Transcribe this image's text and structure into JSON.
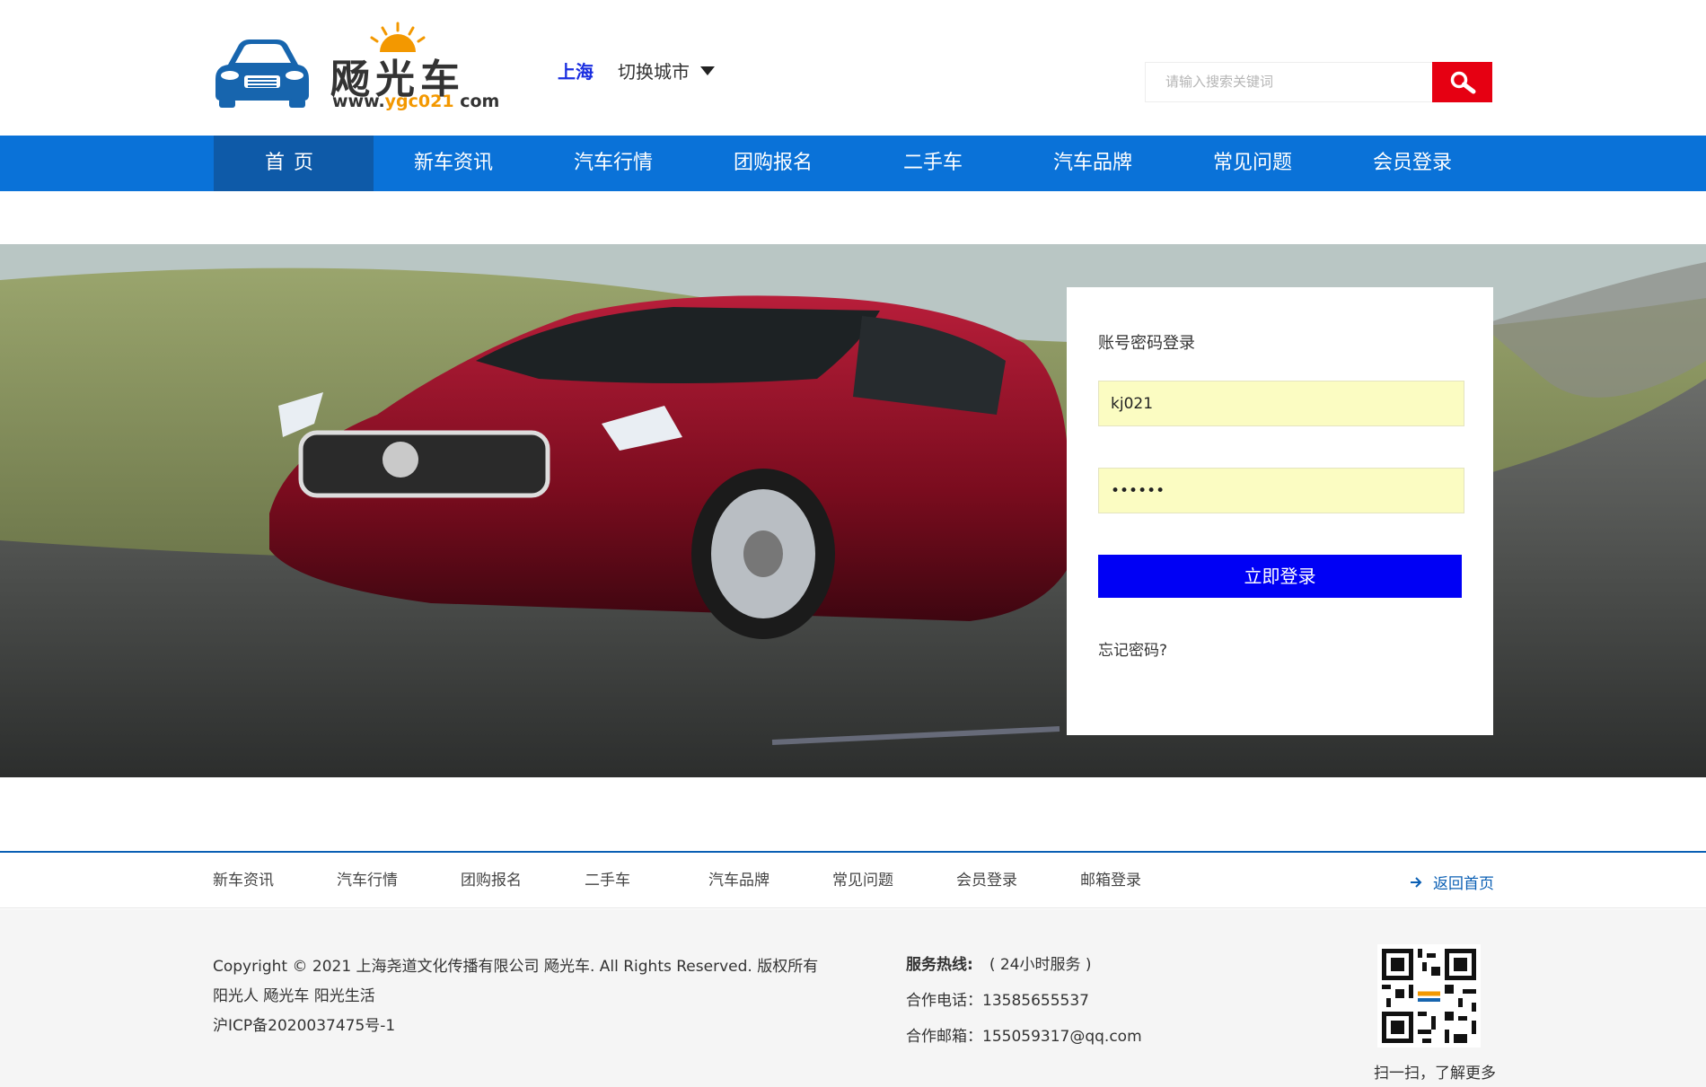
{
  "logo": {
    "name": "飏光车",
    "url_prefix": "www.",
    "url_highlight": "ygc021",
    "url_suffix": " com"
  },
  "header": {
    "city": "上海",
    "switch_city": "切换城市"
  },
  "search": {
    "placeholder": "请输入搜索关键词"
  },
  "nav": {
    "items": [
      "首页",
      "新车资讯",
      "汽车行情",
      "团购报名",
      "二手车",
      "汽车品牌",
      "常见问题",
      "会员登录"
    ]
  },
  "login": {
    "title": "账号密码登录",
    "username": "kj021",
    "password": "••••••",
    "submit": "立即登录",
    "forgot": "忘记密码?"
  },
  "footer_nav": {
    "items": [
      "新车资讯",
      "汽车行情",
      "团购报名",
      "二手车",
      "汽车品牌",
      "常见问题",
      "会员登录",
      "邮箱登录"
    ],
    "back_home": "返回首页"
  },
  "bottom": {
    "copyright": "Copyright © 2021 上海尧道文化传播有限公司 飏光车. All Rights Reserved. 版权所有",
    "slogan": "阳光人 飏光车 阳光生活",
    "icp": "沪ICP备2020037475号-1",
    "hotline_label": "服务热线:",
    "hotline_value": "( 24小时服务 )",
    "phone": "合作电话：13585655537",
    "email": "合作邮箱：155059317@qq.com",
    "qr_caption": "扫一扫，了解更多"
  },
  "colors": {
    "nav_blue": "#0a72d8",
    "nav_active": "#0e5aa8",
    "search_red": "#e60012",
    "login_btn": "#0000f5",
    "input_fill": "#fbfcc2"
  }
}
